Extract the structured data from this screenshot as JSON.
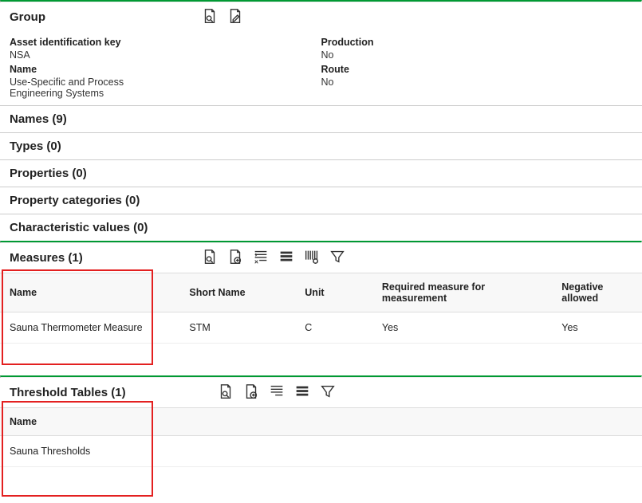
{
  "group": {
    "title": "Group",
    "fields": {
      "asset_key_label": "Asset identification key",
      "asset_key_value": "NSA",
      "name_label": "Name",
      "name_value": "Use-Specific and Process Engineering Systems",
      "production_label": "Production",
      "production_value": "No",
      "route_label": "Route",
      "route_value": "No"
    }
  },
  "sections": {
    "names": "Names (9)",
    "types": "Types (0)",
    "properties": "Properties (0)",
    "property_categories": "Property categories (0)",
    "characteristic_values": "Characteristic values (0)"
  },
  "measures": {
    "title": "Measures (1)",
    "columns": {
      "name": "Name",
      "short_name": "Short Name",
      "unit": "Unit",
      "required": "Required measure for measurement",
      "negative": "Negative allowed"
    },
    "rows": [
      {
        "name": "Sauna Thermometer Measure",
        "short_name": "STM",
        "unit": "C",
        "required": "Yes",
        "negative": "Yes"
      }
    ]
  },
  "thresholds": {
    "title": "Threshold Tables (1)",
    "columns": {
      "name": "Name"
    },
    "rows": [
      {
        "name": "Sauna Thresholds"
      }
    ]
  }
}
